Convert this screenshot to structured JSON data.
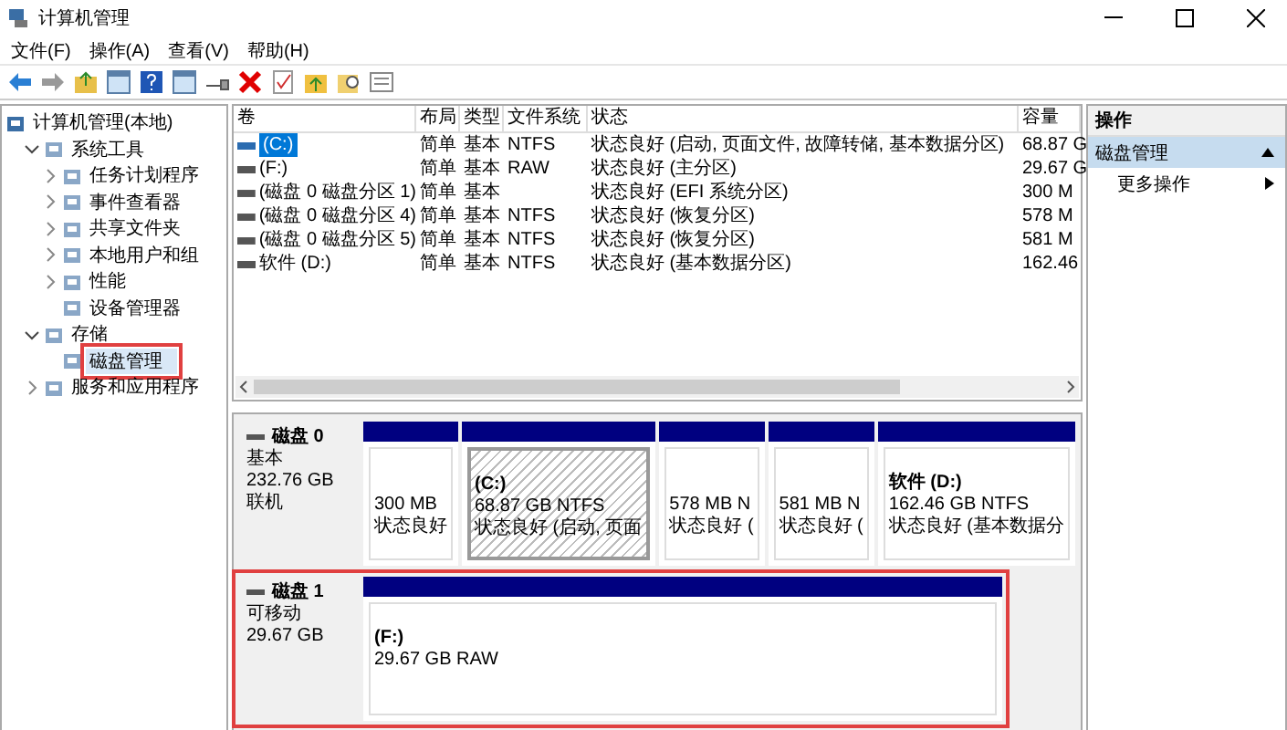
{
  "window": {
    "title": "计算机管理"
  },
  "menu": [
    "文件(F)",
    "操作(A)",
    "查看(V)",
    "帮助(H)"
  ],
  "tree": {
    "label": "计算机管理(本地)",
    "children": [
      {
        "label": "系统工具",
        "expanded": true,
        "children": [
          {
            "label": "任务计划程序",
            "expanded": false
          },
          {
            "label": "事件查看器",
            "expanded": false
          },
          {
            "label": "共享文件夹",
            "expanded": false
          },
          {
            "label": "本地用户和组",
            "expanded": false
          },
          {
            "label": "性能",
            "expanded": false
          },
          {
            "label": "设备管理器"
          }
        ]
      },
      {
        "label": "存储",
        "expanded": true,
        "children": [
          {
            "label": "磁盘管理",
            "selected": true,
            "highlighted": true
          }
        ]
      },
      {
        "label": "服务和应用程序",
        "expanded": false
      }
    ]
  },
  "table": {
    "columns": [
      "卷",
      "布局",
      "类型",
      "文件系统",
      "状态",
      "容量"
    ],
    "rows": [
      {
        "selected": true,
        "cells": [
          "(C:)",
          "简单",
          "基本",
          "NTFS",
          "状态良好 (启动, 页面文件, 故障转储, 基本数据分区)",
          "68.87 G"
        ]
      },
      {
        "selected": false,
        "cells": [
          "(F:)",
          "简单",
          "基本",
          "RAW",
          "状态良好 (主分区)",
          "29.67 G"
        ]
      },
      {
        "selected": false,
        "cells": [
          "(磁盘 0 磁盘分区 1)",
          "简单",
          "基本",
          "",
          "状态良好 (EFI 系统分区)",
          "300 M"
        ]
      },
      {
        "selected": false,
        "cells": [
          "(磁盘 0 磁盘分区 4)",
          "简单",
          "基本",
          "NTFS",
          "状态良好 (恢复分区)",
          "578 M"
        ]
      },
      {
        "selected": false,
        "cells": [
          "(磁盘 0 磁盘分区 5)",
          "简单",
          "基本",
          "NTFS",
          "状态良好 (恢复分区)",
          "581 M"
        ]
      },
      {
        "selected": false,
        "cells": [
          "软件 (D:)",
          "简单",
          "基本",
          "NTFS",
          "状态良好 (基本数据分区)",
          "162.46"
        ]
      }
    ]
  },
  "disks": [
    {
      "name": "磁盘 0",
      "type": "基本",
      "size": "232.76 GB",
      "status": "联机",
      "highlighted": false,
      "partitions": [
        {
          "size": "300 MB",
          "status": "状态良好",
          "selected": false
        },
        {
          "label": "(C:)",
          "size": "68.87 GB NTFS",
          "status": "状态良好 (启动, 页面",
          "selected": true
        },
        {
          "size": "578 MB N",
          "status": "状态良好 (",
          "selected": false
        },
        {
          "size": "581 MB N",
          "status": "状态良好 (",
          "selected": false
        },
        {
          "label": "软件  (D:)",
          "size": "162.46 GB NTFS",
          "status": "状态良好 (基本数据分",
          "selected": false
        }
      ]
    },
    {
      "name": "磁盘 1",
      "type": "可移动",
      "size": "29.67 GB",
      "highlighted": true,
      "partitions": [
        {
          "label": "(F:)",
          "size": "29.67 GB RAW",
          "selected": false
        }
      ]
    }
  ],
  "actions": {
    "header": "操作",
    "items": [
      {
        "label": "磁盘管理",
        "kind": "section"
      },
      {
        "label": "更多操作",
        "kind": "submenu"
      }
    ]
  }
}
